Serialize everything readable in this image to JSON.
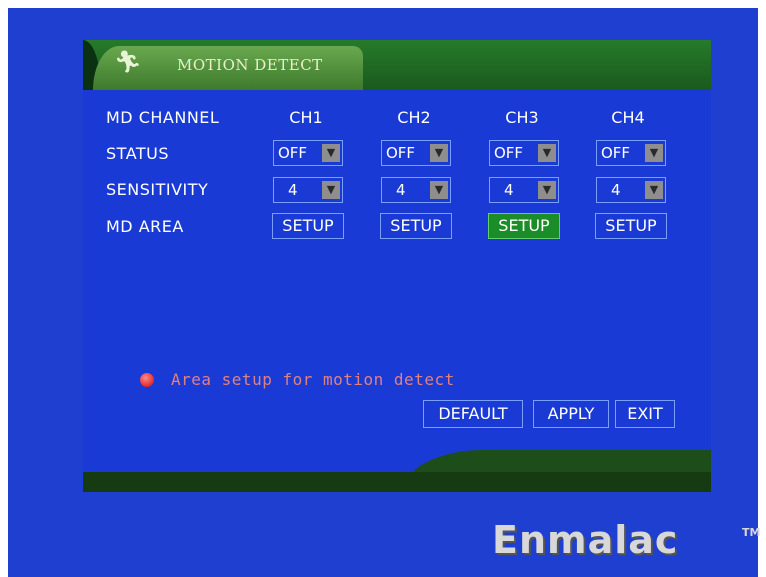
{
  "window": {
    "title": "MOTION DETECT"
  },
  "rows": {
    "md_channel": "MD CHANNEL",
    "status": "STATUS",
    "sensitivity": "SENSITIVITY",
    "md_area": "MD AREA"
  },
  "channels": [
    {
      "name": "CH1",
      "status": "OFF",
      "sensitivity": "4",
      "area": "SETUP"
    },
    {
      "name": "CH2",
      "status": "OFF",
      "sensitivity": "4",
      "area": "SETUP"
    },
    {
      "name": "CH3",
      "status": "OFF",
      "sensitivity": "4",
      "area": "SETUP"
    },
    {
      "name": "CH4",
      "status": "OFF",
      "sensitivity": "4",
      "area": "SETUP"
    }
  ],
  "selected_channel_area": "CH3",
  "hint": "Area setup for motion detect",
  "buttons": {
    "default": "DEFAULT",
    "apply": "APPLY",
    "exit": "EXIT"
  },
  "brand": {
    "name": "Enmalac",
    "tm": "TM"
  },
  "colors": {
    "background": "#1f3fd0",
    "title_bar": "#267a2a",
    "active_button": "#1a8c28",
    "hint_dot": "#d40000"
  },
  "icons": {
    "title": "running-figure-icon",
    "dropdown": "chevron-down-icon",
    "hint": "red-dot-icon"
  }
}
